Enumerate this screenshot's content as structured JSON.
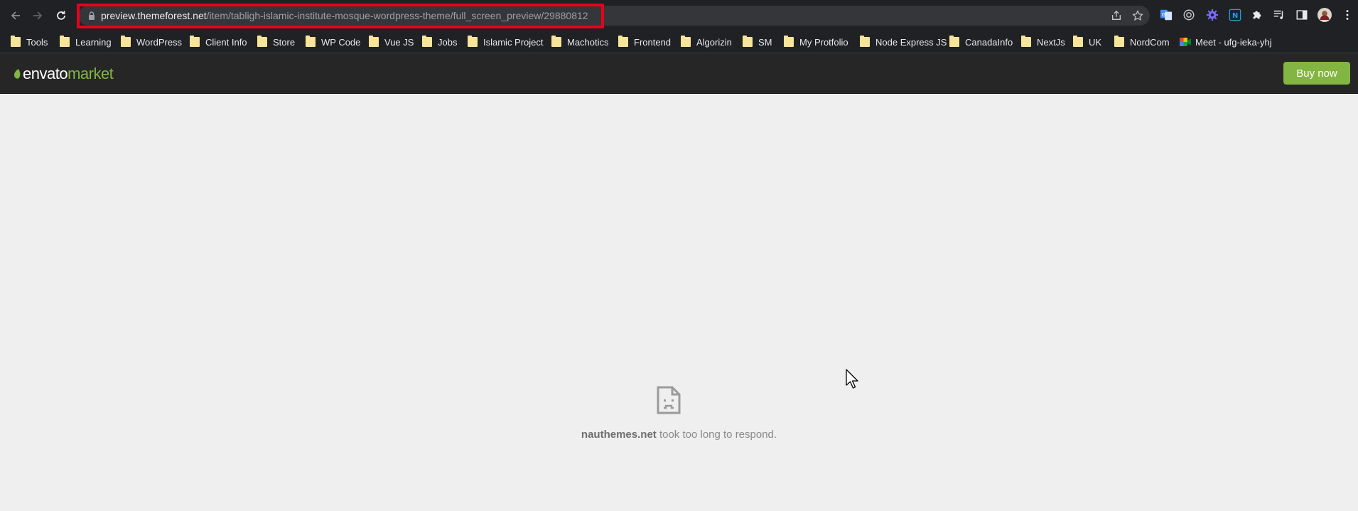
{
  "browser": {
    "url": {
      "domain": "preview.themeforest.net",
      "path": "/item/tabligh-islamic-institute-mosque-wordpress-theme/full_screen_preview/29880812"
    }
  },
  "bookmarks": [
    {
      "label": "Tools"
    },
    {
      "label": "Learning"
    },
    {
      "label": "WordPress"
    },
    {
      "label": "Client Info"
    },
    {
      "label": "Store"
    },
    {
      "label": "WP Code"
    },
    {
      "label": "Vue JS"
    },
    {
      "label": "Jobs"
    },
    {
      "label": "Islamic Project"
    },
    {
      "label": "Machotics"
    },
    {
      "label": "Frontend"
    },
    {
      "label": "Algorizin"
    },
    {
      "label": "SM"
    },
    {
      "label": "My Protfolio"
    },
    {
      "label": "Node Express JS"
    },
    {
      "label": "CanadaInfo"
    },
    {
      "label": "NextJs"
    },
    {
      "label": "UK"
    },
    {
      "label": "NordCom"
    },
    {
      "label": "Meet - ufg-ieka-yhj"
    }
  ],
  "envato": {
    "logo_envato": "envato",
    "logo_market": "market",
    "buy_label": "Buy now",
    "accent": "#82b541"
  },
  "error": {
    "host": "nauthemes.net",
    "message": " took too long to respond."
  }
}
